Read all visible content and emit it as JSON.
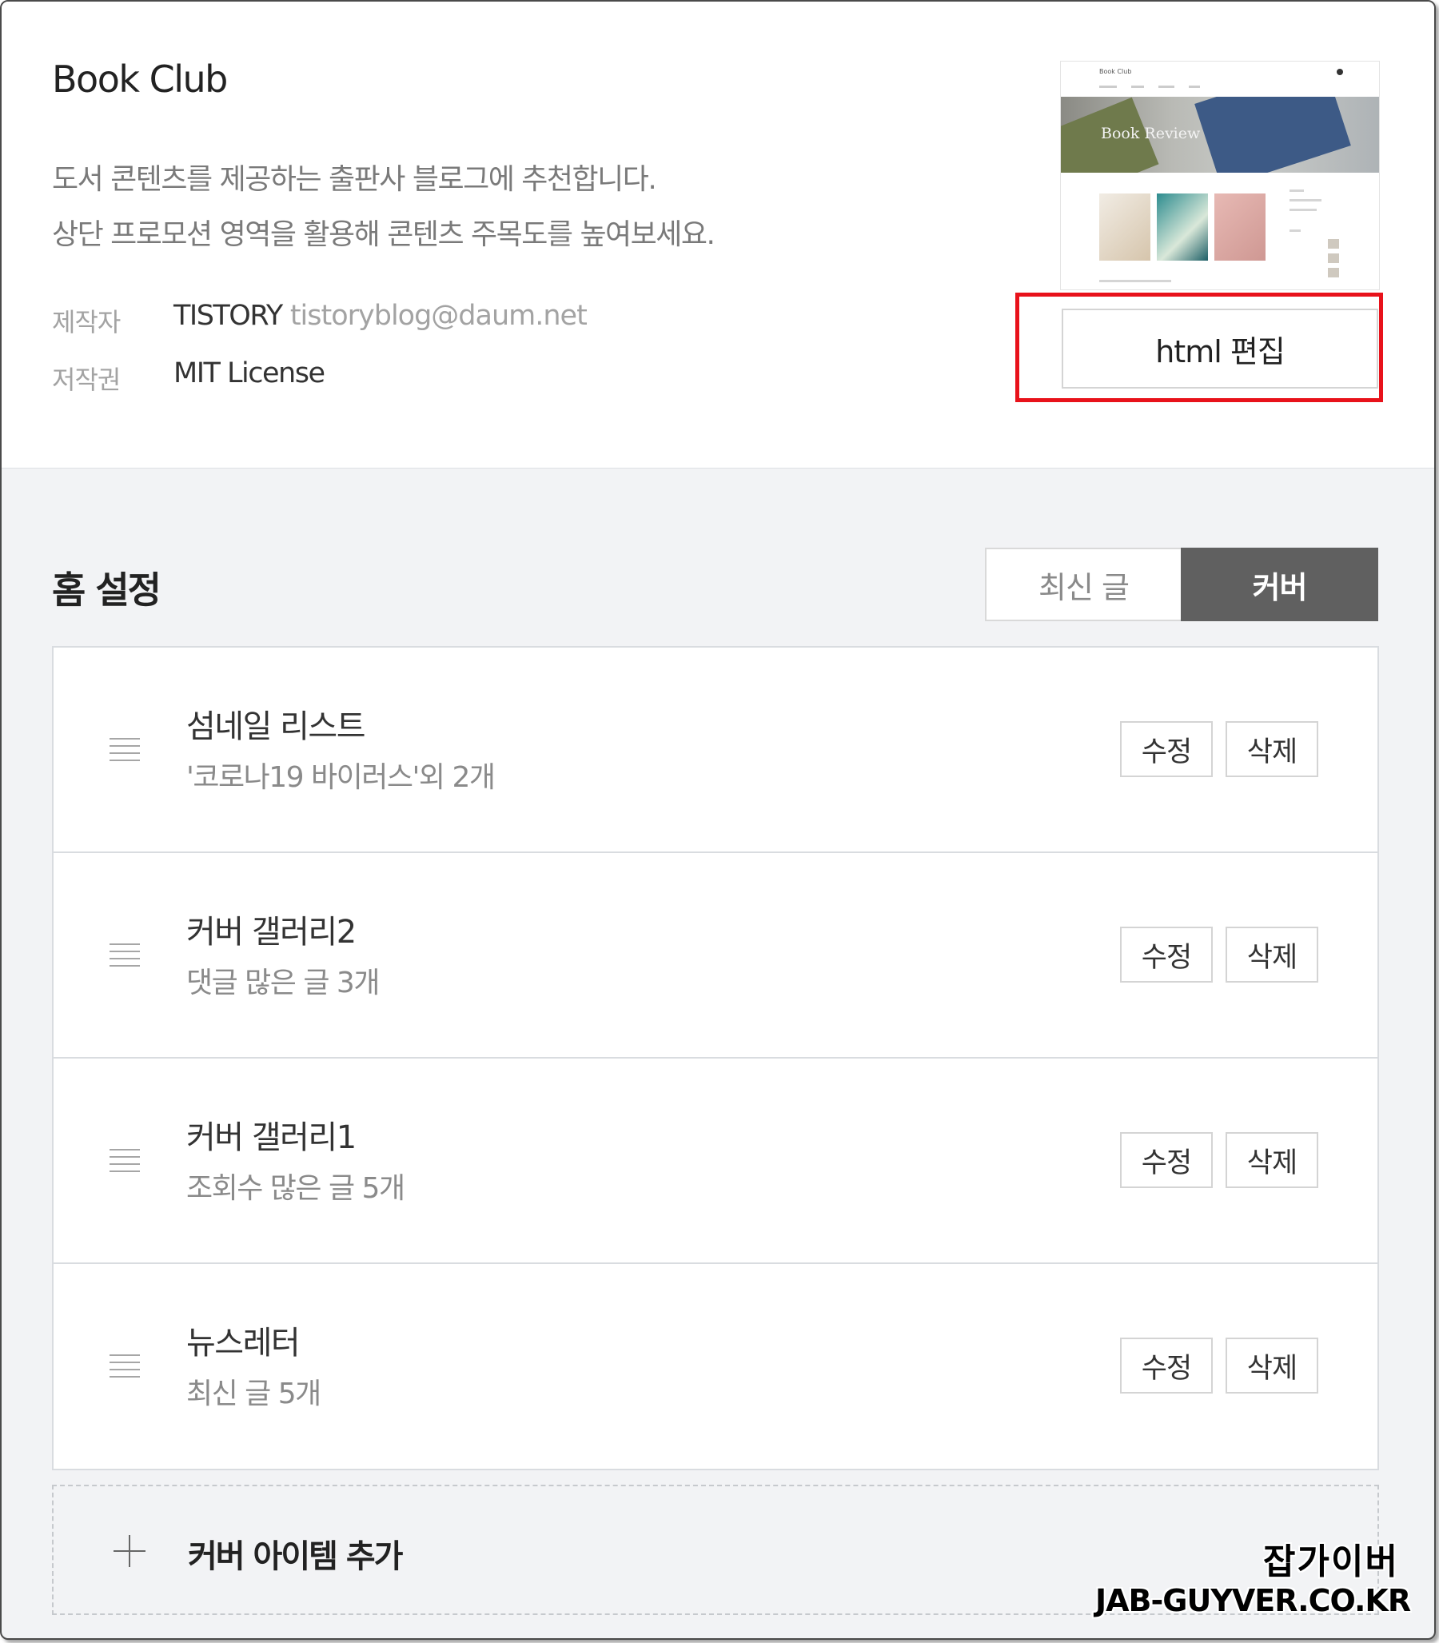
{
  "theme": {
    "name": "Book Club",
    "description_line1": "도서 콘텐츠를 제공하는 출판사 블로그에 추천합니다.",
    "description_line2": "상단 프로모션 영역을 활용해 콘텐츠 주목도를 높여보세요.",
    "maker_label": "제작자",
    "maker_name": "TISTORY",
    "maker_email": "tistoryblog@daum.net",
    "license_label": "저작권",
    "license_value": "MIT License",
    "preview": {
      "logo": "Book Club",
      "banner_text": "Book Review"
    },
    "html_edit_label": "html 편집",
    "highlight_color": "#e8121b"
  },
  "home_settings": {
    "title": "홈 설정",
    "tabs": [
      {
        "label": "최신 글",
        "active": false
      },
      {
        "label": "커버",
        "active": true
      }
    ],
    "items": [
      {
        "title": "섬네일 리스트",
        "subtitle": "'코로나19 바이러스'외 2개",
        "edit_label": "수정",
        "delete_label": "삭제"
      },
      {
        "title": "커버 갤러리2",
        "subtitle": "댓글 많은 글 3개",
        "edit_label": "수정",
        "delete_label": "삭제"
      },
      {
        "title": "커버 갤러리1",
        "subtitle": "조회수 많은 글 5개",
        "edit_label": "수정",
        "delete_label": "삭제"
      },
      {
        "title": "뉴스레터",
        "subtitle": "최신 글 5개",
        "edit_label": "수정",
        "delete_label": "삭제"
      }
    ],
    "add_item_label": "커버 아이템 추가"
  },
  "watermark": {
    "korean": "잡가이버",
    "domain": "JAB-GUYVER.CO.KR"
  },
  "colors": {
    "active_tab": "#606060",
    "background": "#f2f3f5"
  }
}
